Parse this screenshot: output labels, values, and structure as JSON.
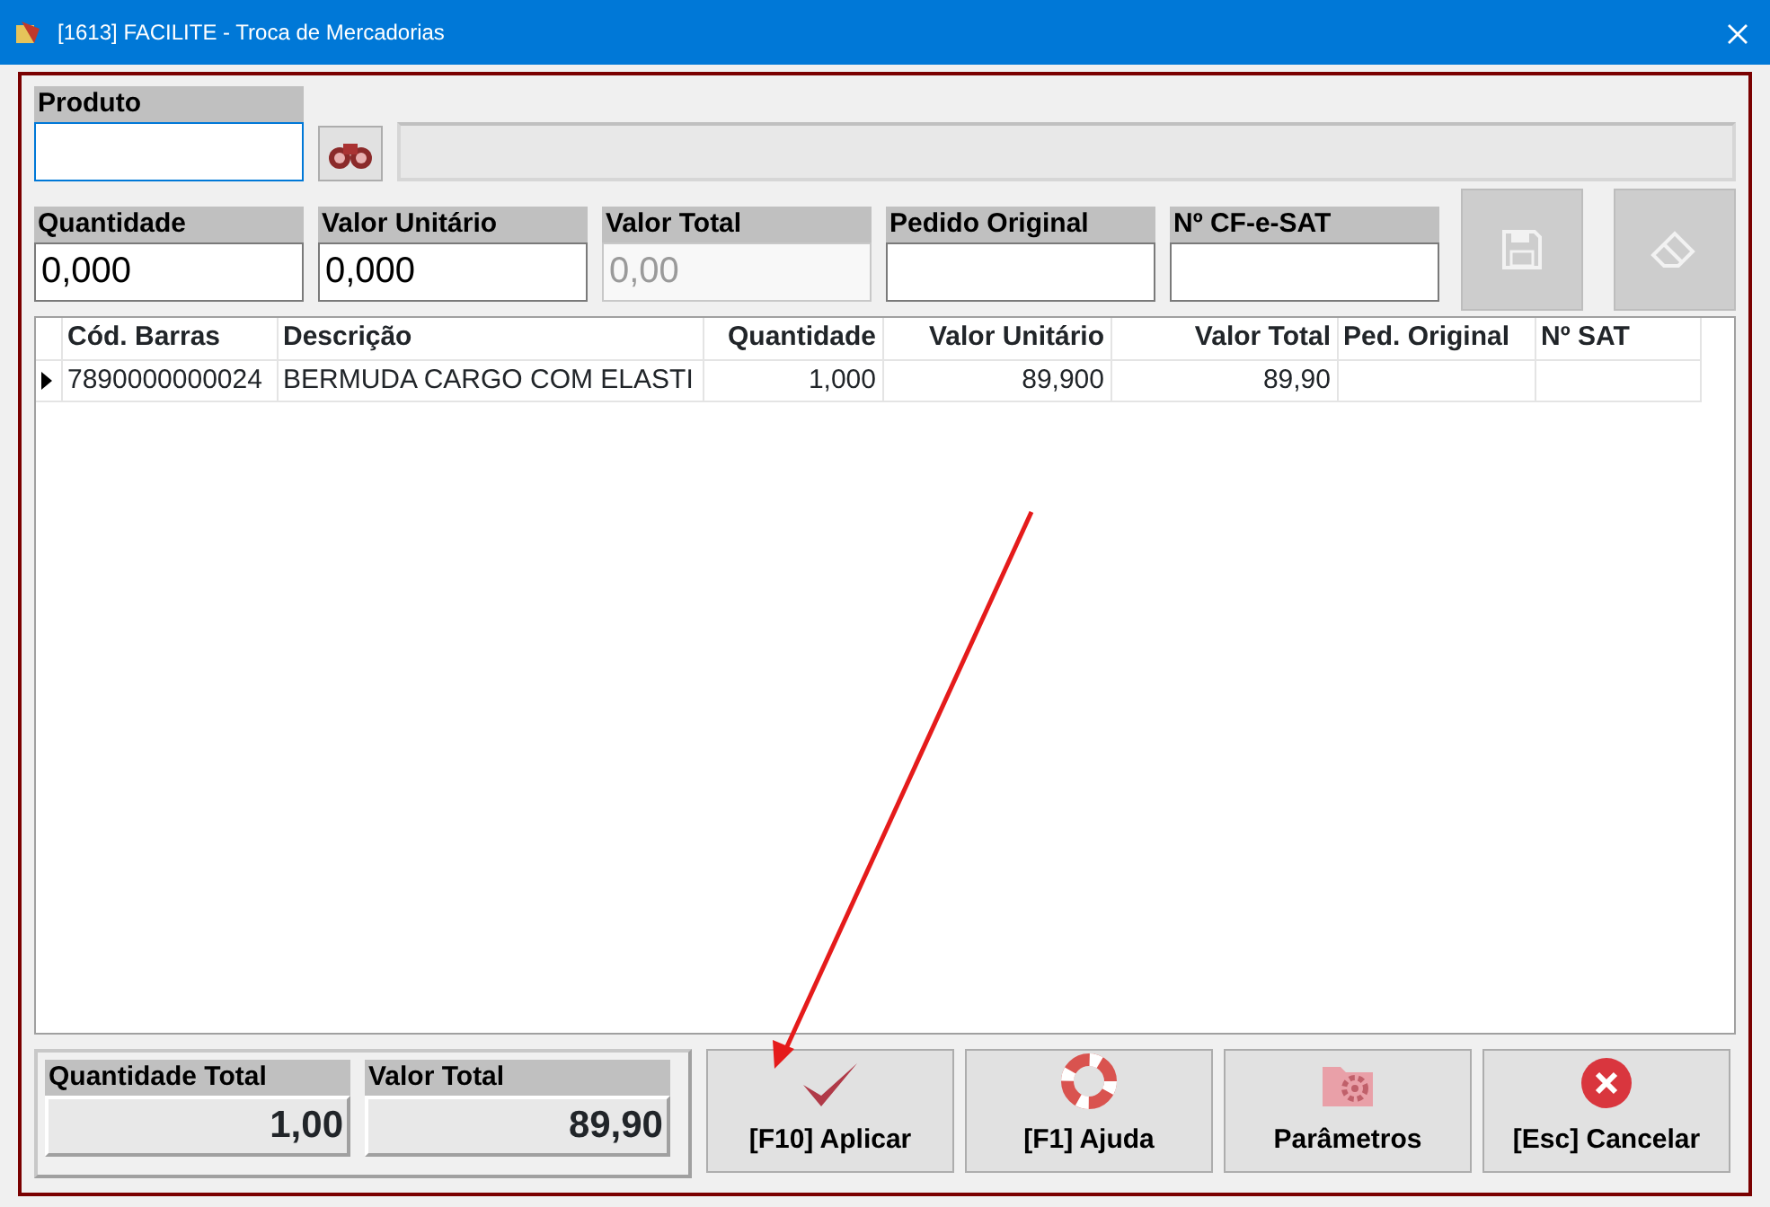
{
  "window": {
    "title": "[1613] FACILITE - Troca de Mercadorias"
  },
  "produto": {
    "label": "Produto"
  },
  "fields": [
    {
      "label": "Quantidade",
      "value": "0,000",
      "disabled": false
    },
    {
      "label": "Valor Unitário",
      "value": "0,000",
      "disabled": false
    },
    {
      "label": "Valor Total",
      "value": "0,00",
      "disabled": true
    },
    {
      "label": "Pedido Original",
      "disabled": false
    },
    {
      "label": "Nº CF-e-SAT",
      "disabled": false
    }
  ],
  "tool_buttons": [
    {
      "kind": "save",
      "disabled": true
    },
    {
      "kind": "eraser",
      "disabled": true
    }
  ],
  "table": {
    "columns": [
      "Cód. Barras",
      "Descrição",
      "Quantidade",
      "Valor Unitário",
      "Valor Total",
      "Ped. Original",
      "Nº SAT"
    ],
    "rows": [
      {
        "current": true,
        "cells": [
          "7890000000024",
          "BERMUDA CARGO COM ELASTI",
          "1,000",
          "89,900",
          "89,90",
          "",
          ""
        ]
      }
    ]
  },
  "totals": [
    {
      "label": "Quantidade Total",
      "value": "1,00"
    },
    {
      "label": "Valor Total",
      "value": "89,90"
    }
  ],
  "actions": [
    {
      "kind": "check",
      "label": "[F10] Aplicar"
    },
    {
      "kind": "lifebuoy",
      "label": "[F1] Ajuda"
    },
    {
      "kind": "gears",
      "label": "Parâmetros"
    },
    {
      "kind": "cancel",
      "label": "[Esc] Cancelar"
    }
  ]
}
